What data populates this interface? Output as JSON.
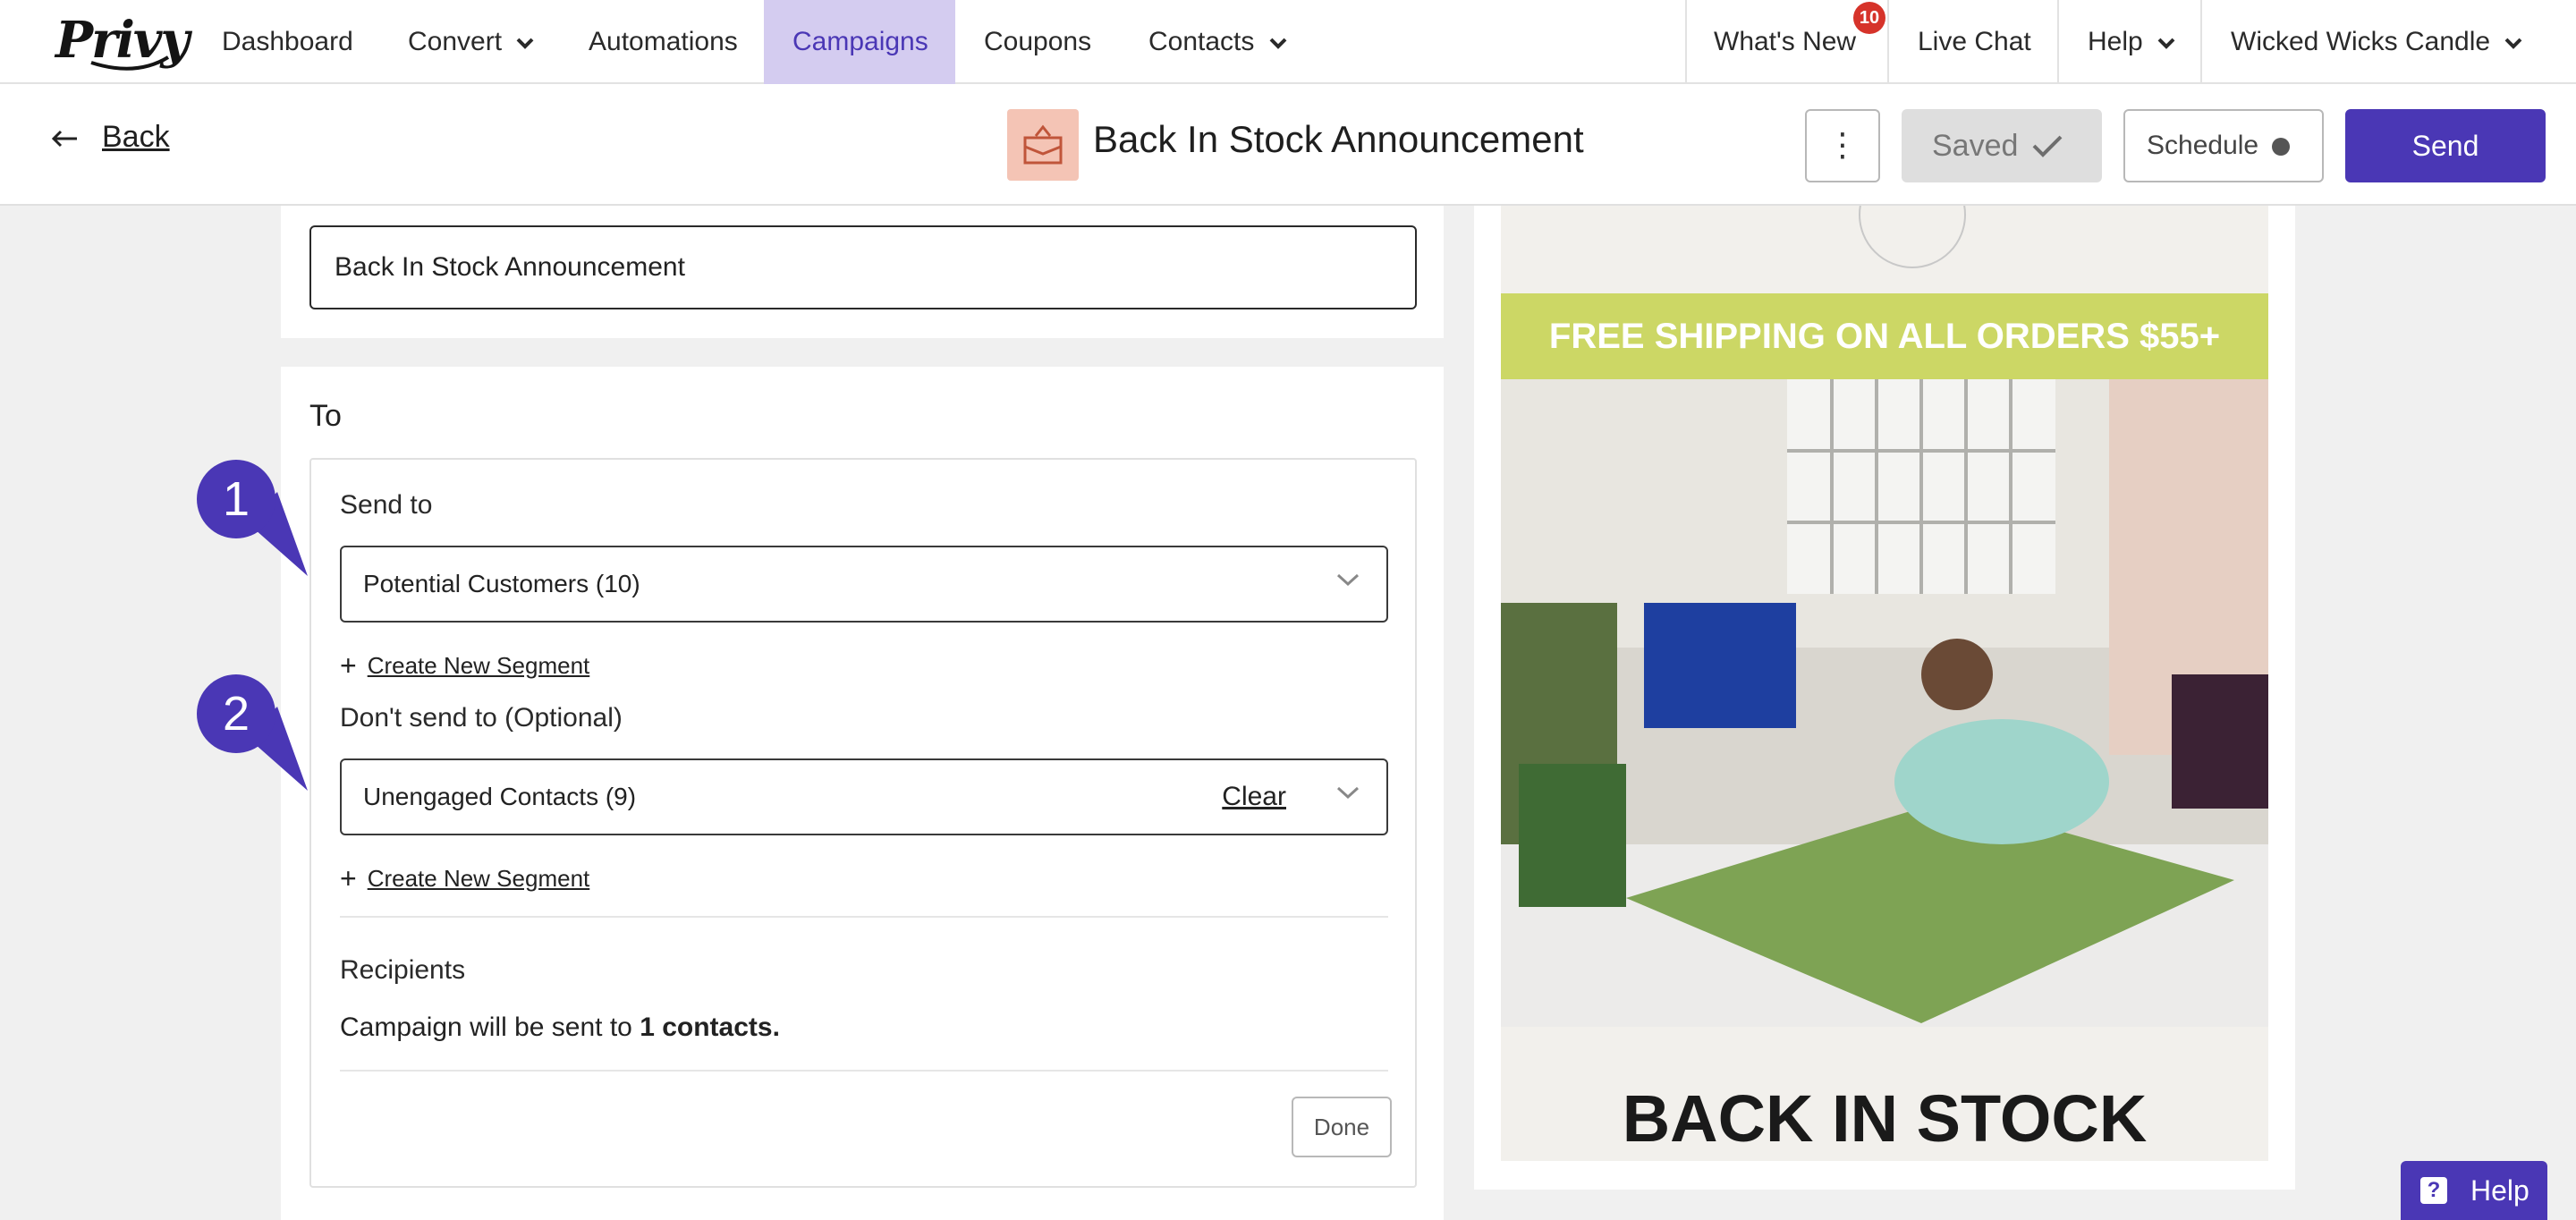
{
  "nav": {
    "logo": "Privy",
    "items": [
      {
        "label": "Dashboard"
      },
      {
        "label": "Convert"
      },
      {
        "label": "Automations"
      },
      {
        "label": "Campaigns"
      },
      {
        "label": "Coupons"
      },
      {
        "label": "Contacts"
      }
    ],
    "whats_new": "What's New",
    "whats_new_badge": "10",
    "live_chat": "Live Chat",
    "help": "Help",
    "account": "Wicked Wicks Candle"
  },
  "header": {
    "back": "Back",
    "title": "Back In Stock Announcement",
    "saved": "Saved",
    "schedule": "Schedule",
    "send": "Send"
  },
  "editor": {
    "campaign_name_value": "Back In Stock Announcement",
    "to_label": "To",
    "send_to_label": "Send to",
    "send_to_value": "Potential Customers (10)",
    "create_segment": "Create New Segment",
    "dont_send_label": "Don't send to (Optional)",
    "dont_send_value": "Unengaged Contacts (9)",
    "clear": "Clear",
    "recipients_label": "Recipients",
    "recipients_prefix": "Campaign will be sent to",
    "recipients_count": "1 contacts.",
    "done": "Done"
  },
  "steps": [
    "1",
    "2"
  ],
  "preview": {
    "shipping_banner": "FREE SHIPPING ON ALL ORDERS $55+",
    "headline": "BACK IN STOCK"
  },
  "help_widget": "Help",
  "colors": {
    "brand_purple": "#4a37b5",
    "nav_active_bg": "#d4ccf0",
    "banner_green": "#ccd765",
    "badge_red": "#d6332a"
  }
}
